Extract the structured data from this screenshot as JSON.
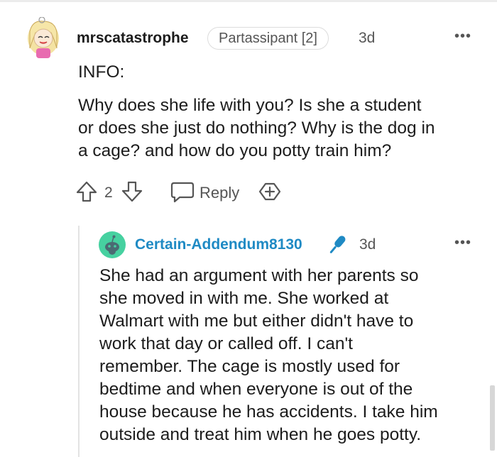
{
  "comment": {
    "username": "mrscatastrophe",
    "flair": "Partassipant [2]",
    "time": "3d",
    "more_icon": "more-horizontal-icon",
    "info_label": "INFO:",
    "body_lines": [
      "Why does she life with you? Is she a student",
      "or does she just do nothing? Why is the dog in",
      "a cage? and how do you potty train him?"
    ],
    "vote_count": "2",
    "reply_label": "Reply",
    "icons": [
      "upvote-icon",
      "downvote-icon",
      "reply-bubble-icon",
      "award-icon"
    ]
  },
  "reply": {
    "username": "Certain-Addendum8130",
    "username_color": "#1f8ac4",
    "time": "3d",
    "mic_color": "#1f8ac4",
    "body_lines": [
      "She had an argument with her parents so",
      "she moved in with me. She worked at",
      "Walmart with me but either didn't have to",
      "work that day or called off. I can't",
      "remember. The cage is mostly used for",
      "bedtime and when everyone is out of the",
      "house because he has accidents. I take him",
      "outside and treat him when he goes potty."
    ]
  }
}
